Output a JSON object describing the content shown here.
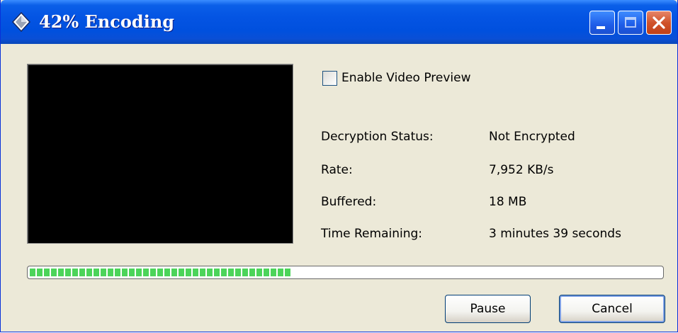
{
  "window": {
    "title": "42% Encoding",
    "icon": "diamond-app-icon",
    "buttons": {
      "minimize": "minimize-icon",
      "maximize": "maximize-icon",
      "close": "close-icon"
    }
  },
  "preview": {
    "enable_label": "Enable Video Preview",
    "enabled": false
  },
  "info": [
    {
      "label": "Decryption Status:",
      "value": "Not Encrypted"
    },
    {
      "label": "Rate:",
      "value": "7,952 KB/s"
    },
    {
      "label": "Buffered:",
      "value": "18 MB"
    },
    {
      "label": "Time Remaining:",
      "value": "3 minutes 39 seconds"
    }
  ],
  "progress": {
    "percent": 42,
    "color": "#4CD45A"
  },
  "actions": {
    "pause": "Pause",
    "cancel": "Cancel"
  },
  "colors": {
    "titlebar": "#0050DE",
    "window_bg": "#ECE9D8",
    "close": "#D0532B"
  }
}
